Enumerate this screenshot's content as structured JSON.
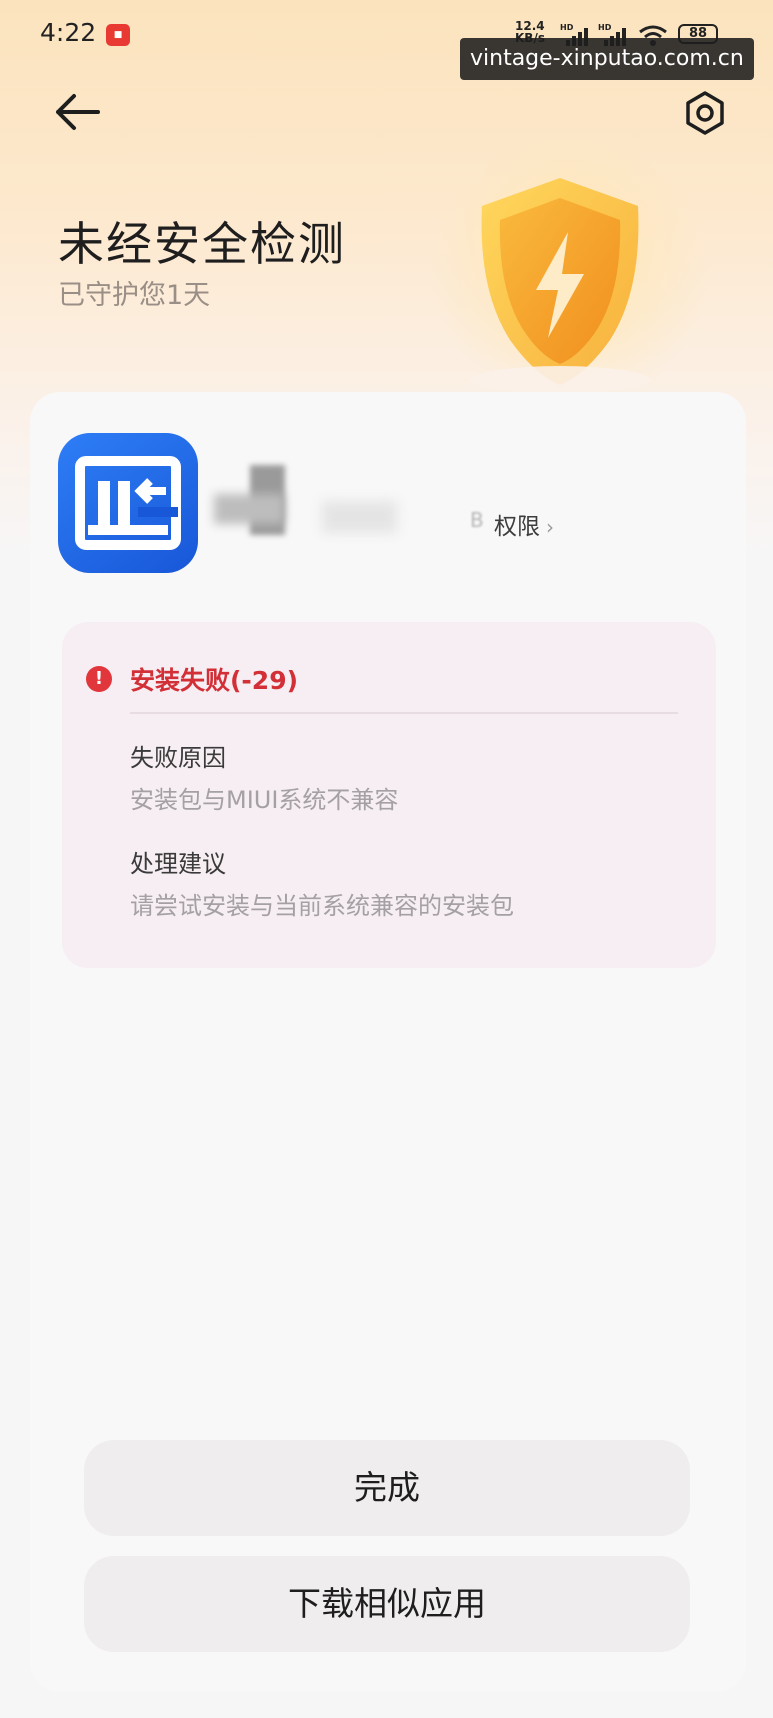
{
  "status_bar": {
    "time": "4:22",
    "net_speed_value": "12.4",
    "net_speed_unit": "KB/s",
    "battery": "88",
    "notification_icon": "red-app-badge-icon",
    "watermark": "vintage-xinputao.com.cn"
  },
  "toolbar": {
    "back_icon": "arrow-left-icon",
    "settings_icon": "hex-gear-icon"
  },
  "hero": {
    "title": "未经安全检测",
    "subtitle": "已守护您1天",
    "graphic": "lightning-shield-icon"
  },
  "app": {
    "icon": "monitor-app-icon",
    "size_fragment": "B",
    "permissions_label": "权限",
    "permissions_chevron": "›"
  },
  "error": {
    "title": "安装失败(-29)",
    "reason_label": "失败原因",
    "reason_value": "安装包与MIUI系统不兼容",
    "suggestion_label": "处理建议",
    "suggestion_value": "请尝试安装与当前系统兼容的安装包",
    "accent_color": "#d32f37"
  },
  "buttons": {
    "done": "完成",
    "download_similar": "下载相似应用"
  }
}
